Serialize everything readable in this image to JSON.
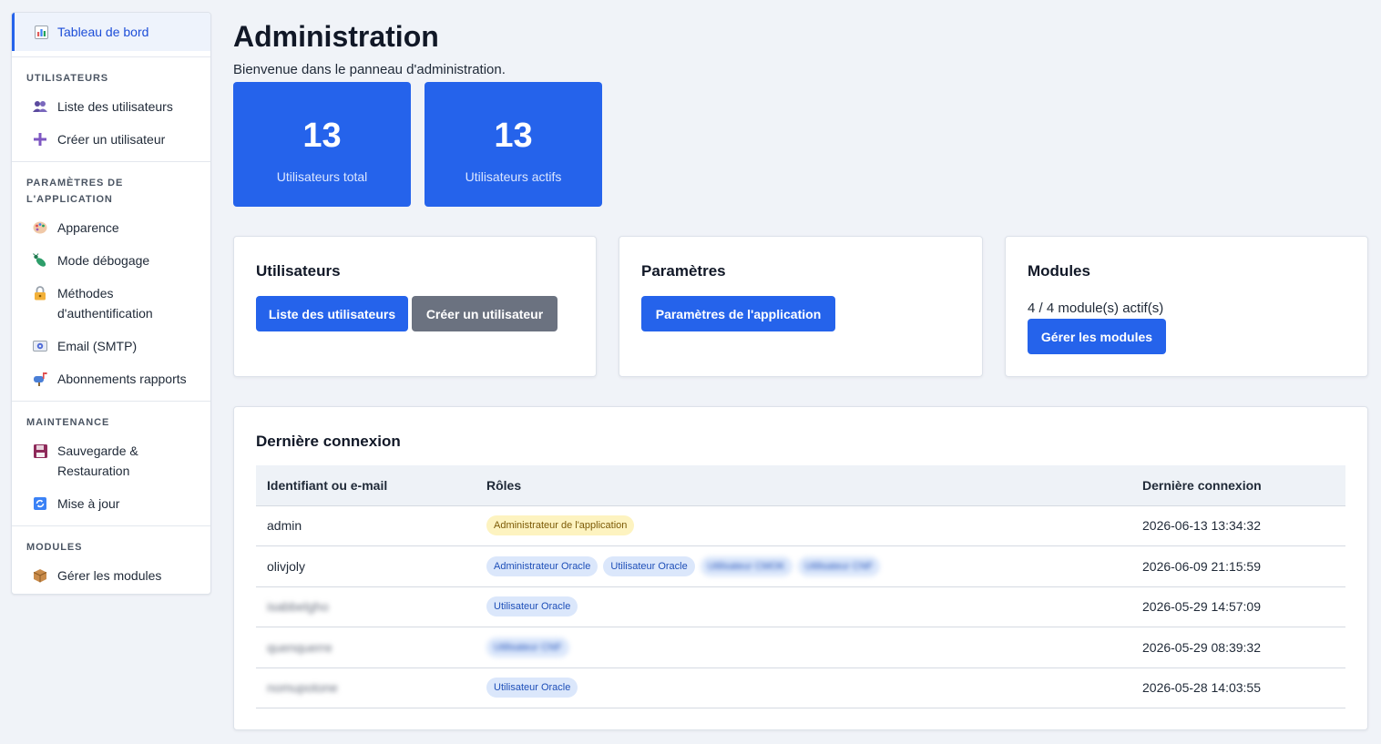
{
  "sidebar": {
    "active": {
      "label": "Tableau de bord",
      "icon": "bar-chart-icon"
    },
    "sections": [
      {
        "title": "UTILISATEURS",
        "items": [
          {
            "label": "Liste des utilisateurs",
            "icon": "users-icon"
          },
          {
            "label": "Créer un utilisateur",
            "icon": "plus-icon"
          }
        ]
      },
      {
        "title": "PARAMÈTRES DE L'APPLICATION",
        "items": [
          {
            "label": "Apparence",
            "icon": "palette-icon"
          },
          {
            "label": "Mode débogage",
            "icon": "bug-icon"
          },
          {
            "label": "Méthodes d'authentification",
            "icon": "lock-icon"
          },
          {
            "label": "Email (SMTP)",
            "icon": "email-icon"
          },
          {
            "label": "Abonnements rapports",
            "icon": "mailbox-icon"
          }
        ]
      },
      {
        "title": "MAINTENANCE",
        "items": [
          {
            "label": "Sauvegarde & Restauration",
            "icon": "floppy-disk-icon"
          },
          {
            "label": "Mise à jour",
            "icon": "refresh-icon"
          }
        ]
      },
      {
        "title": "MODULES",
        "items": [
          {
            "label": "Gérer les modules",
            "icon": "package-icon"
          }
        ]
      }
    ]
  },
  "header": {
    "title": "Administration",
    "subtitle": "Bienvenue dans le panneau d'administration."
  },
  "stats": [
    {
      "value": "13",
      "label": "Utilisateurs total"
    },
    {
      "value": "13",
      "label": "Utilisateurs actifs"
    }
  ],
  "cards": {
    "users": {
      "title": "Utilisateurs",
      "btn_list": "Liste des utilisateurs",
      "btn_create": "Créer un utilisateur"
    },
    "settings": {
      "title": "Paramètres",
      "btn_settings": "Paramètres de l'application"
    },
    "modules": {
      "title": "Modules",
      "info": "4 / 4 module(s) actif(s)",
      "btn_manage": "Gérer les modules"
    }
  },
  "last_login": {
    "title": "Dernière connexion",
    "columns": [
      "Identifiant ou e-mail",
      "Rôles",
      "Dernière connexion"
    ],
    "rows": [
      {
        "user": "admin",
        "blurred": false,
        "roles": [
          {
            "label": "Administrateur de l'application",
            "color": "yellow",
            "blurred": false
          }
        ],
        "last": "2026-06-13 13:34:32"
      },
      {
        "user": "olivjoly",
        "blurred": false,
        "roles": [
          {
            "label": "Administrateur Oracle",
            "color": "blue",
            "blurred": false
          },
          {
            "label": "Utilisateur Oracle",
            "color": "blue",
            "blurred": false
          },
          {
            "label": "Utilisateur CMOK",
            "color": "blue",
            "blurred": true
          },
          {
            "label": "Utilisateur CNF",
            "color": "blue",
            "blurred": true
          }
        ],
        "last": "2026-06-09 21:15:59"
      },
      {
        "user": "isabbelgho",
        "blurred": true,
        "roles": [
          {
            "label": "Utilisateur Oracle",
            "color": "blue",
            "blurred": false
          }
        ],
        "last": "2026-05-29 14:57:09"
      },
      {
        "user": "quenquerre",
        "blurred": true,
        "roles": [
          {
            "label": "Utilisateur CNF",
            "color": "blue",
            "blurred": true
          }
        ],
        "last": "2026-05-29 08:39:32"
      },
      {
        "user": "nomupotone",
        "blurred": true,
        "roles": [
          {
            "label": "Utilisateur Oracle",
            "color": "blue",
            "blurred": false
          }
        ],
        "last": "2026-05-28 14:03:55"
      }
    ]
  },
  "colors": {
    "primary": "#2563eb",
    "secondary": "#6b7280",
    "background": "#f0f3f8",
    "badge_yellow": "#fdf3c0",
    "badge_blue": "#dbe7fb"
  }
}
